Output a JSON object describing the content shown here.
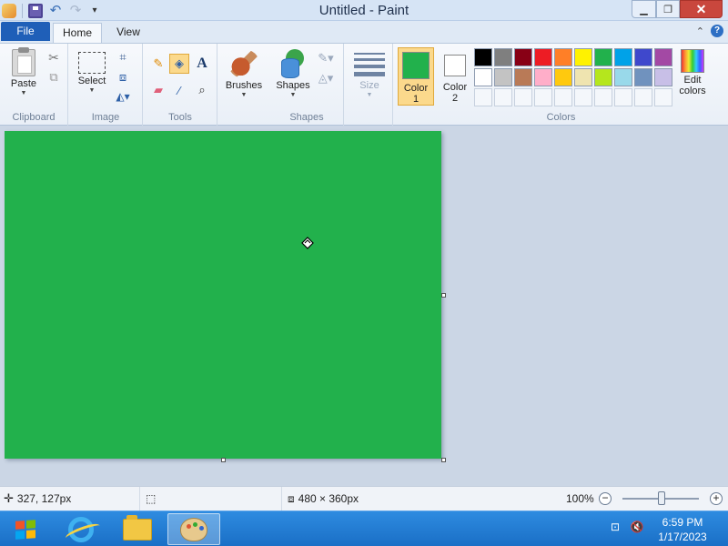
{
  "window": {
    "title": "Untitled - Paint"
  },
  "tabs": {
    "file": "File",
    "home": "Home",
    "view": "View"
  },
  "ribbon": {
    "clipboard": {
      "paste": "Paste",
      "group": "Clipboard"
    },
    "image": {
      "select": "Select",
      "group": "Image"
    },
    "tools": {
      "group": "Tools"
    },
    "brushes": {
      "label": "Brushes"
    },
    "shapes": {
      "label": "Shapes",
      "group": "Shapes"
    },
    "size": {
      "label": "Size"
    },
    "colors": {
      "color1": "Color",
      "color1_num": "1",
      "color2": "Color",
      "color2_num": "2",
      "edit_line1": "Edit",
      "edit_line2": "colors",
      "group": "Colors",
      "color1_value": "#22b14c",
      "color2_value": "#ffffff",
      "palette_row1": [
        "#000000",
        "#7f7f7f",
        "#880015",
        "#ed1c24",
        "#ff7f27",
        "#fff200",
        "#22b14c",
        "#00a2e8",
        "#3f48cc",
        "#a349a4"
      ],
      "palette_row2": [
        "#ffffff",
        "#c3c3c3",
        "#b97a57",
        "#ffaec9",
        "#ffc90e",
        "#efe4b0",
        "#b5e61d",
        "#99d9ea",
        "#7092be",
        "#c8bfe7"
      ],
      "palette_row3_empty": 10
    }
  },
  "canvas": {
    "fill_color": "#22b14c"
  },
  "status": {
    "cursor_pos": "327, 127px",
    "canvas_size": "480 × 360px",
    "zoom": "100%"
  },
  "taskbar": {
    "time": "6:59 PM",
    "date": "1/17/2023"
  }
}
